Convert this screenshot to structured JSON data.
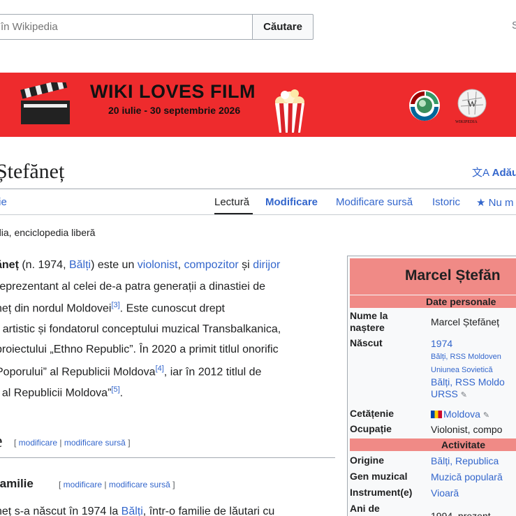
{
  "search": {
    "placeholder": "în Wikipedia",
    "button": "Căutare",
    "edge_char": "S"
  },
  "banner": {
    "title": "WIKI LOVES FILM",
    "dates": "20 iulie - 30 septembrie 2026",
    "logo_small_text": "WIKIPEDIA"
  },
  "page": {
    "title": "Ștefăneț",
    "lang_button": "Adău",
    "tabs_left": "ție",
    "tabs": [
      "Lectură",
      "Modificare",
      "Modificare sursă",
      "Istoric",
      "Nu m"
    ],
    "tagline": "dia, enciclopedia liberă"
  },
  "lead": {
    "l1": [
      "ăneț",
      " (n. 1974, ",
      "Bălți",
      ") este un ",
      "violonist",
      ", ",
      "compozitor",
      " și ",
      "dirijor"
    ],
    "l2": "reprezentant al celei de-a patra generații a dinastiei de",
    "l3": [
      "neț din nordul Moldovei",
      "[3]",
      ". Este cunoscut drept"
    ],
    "l4": "r artistic și fondatorul conceptului muzical Transbalkanica,",
    "l5": "proiectului „Ethno Republic”. În 2020 a primit titlul onorific",
    "l6": [
      "Poporului” al Republicii Moldova",
      "[4]",
      ", iar în 2012 titlul de"
    ],
    "l7": [
      "t al Republicii Moldova”",
      "[5]",
      "."
    ]
  },
  "sections": {
    "h2": "e",
    "h3": "familie",
    "edit": "modificare",
    "edit_source": "modificare sursă",
    "last_line": [
      "neț s-a născut în 1974 la ",
      "Bălți",
      ", într-o familie de lăutari cu"
    ]
  },
  "infobox": {
    "title": "Marcel Ștefăn",
    "head_personal": "Date personale",
    "head_activity": "Activitate",
    "rows": {
      "birth_name": {
        "label1": "Nume la",
        "label2": "naștere",
        "value": "Marcel Ștefăneț"
      },
      "born": {
        "label": "Născut",
        "year": "1974",
        "place_small": "Bălți, RSS Moldoven",
        "place_small2": "Uniunea Sovietică",
        "place": "Bălți, RSS Moldo",
        "place2": "URSS"
      },
      "citizenship": {
        "label": "Cetățenie",
        "value": "Moldova"
      },
      "occupation": {
        "label": "Ocupație",
        "value": "Violonist, compo"
      },
      "origin": {
        "label": "Origine",
        "value": "Bălți, Republica"
      },
      "genre": {
        "label": "Gen muzical",
        "value": "Muzică populară"
      },
      "instrument": {
        "label": "Instrument(e)",
        "value": "Vioară"
      },
      "years": {
        "label": "Ani de",
        "value": "1994–prezent"
      }
    }
  },
  "colors": {
    "link": "#3366cc",
    "banner": "#ee2b2d",
    "infobox_header": "#f08a86"
  }
}
